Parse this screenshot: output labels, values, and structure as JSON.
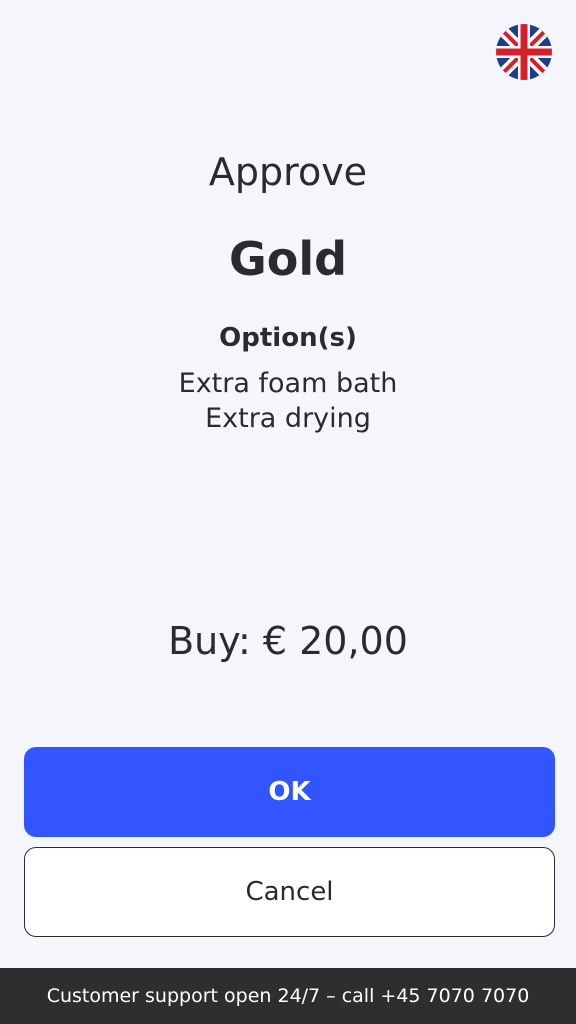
{
  "header": {
    "language_flag_icon": "uk-flag-icon"
  },
  "main": {
    "heading": "Approve",
    "product_name": "Gold",
    "options_label": "Option(s)",
    "options": [
      "Extra foam bath",
      "Extra drying"
    ],
    "price_text": "Buy: € 20,00"
  },
  "actions": {
    "ok_label": "OK",
    "cancel_label": "Cancel"
  },
  "footer": {
    "support_text": "Customer support open 24/7 – call +45 7070 7070"
  },
  "colors": {
    "background": "#f5f6fb",
    "primary_button": "#3355ff",
    "text": "#2b2b2e",
    "footer_bg": "#2e2e30"
  }
}
